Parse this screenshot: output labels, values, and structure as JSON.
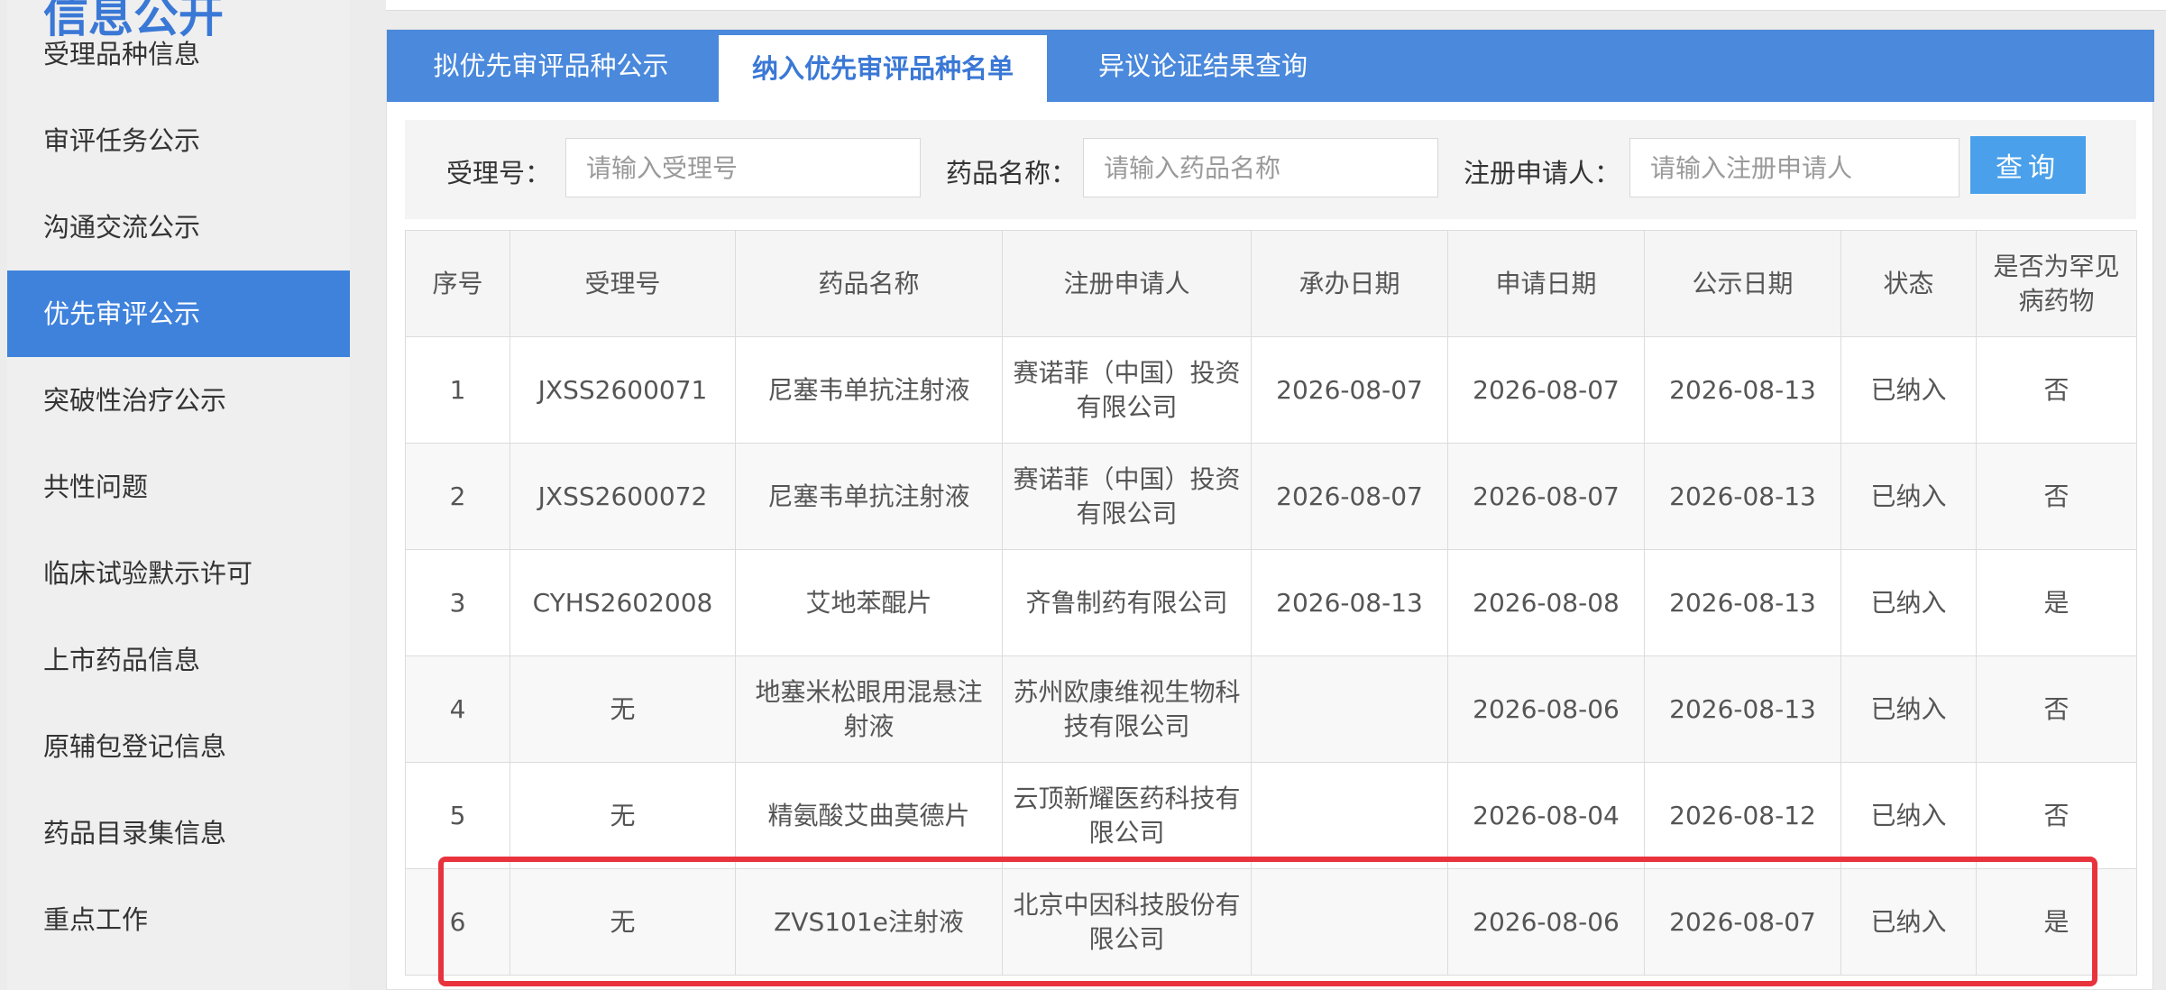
{
  "sidebar": {
    "title": "信息公开",
    "items": [
      {
        "label": "受理品种信息"
      },
      {
        "label": "审评任务公示"
      },
      {
        "label": "沟通交流公示"
      },
      {
        "label": "优先审评公示"
      },
      {
        "label": "突破性治疗公示"
      },
      {
        "label": "共性问题"
      },
      {
        "label": "临床试验默示许可"
      },
      {
        "label": "上市药品信息"
      },
      {
        "label": "原辅包登记信息"
      },
      {
        "label": "药品目录集信息"
      },
      {
        "label": "重点工作"
      }
    ],
    "active_index": 3
  },
  "tabs": [
    {
      "label": "拟优先审评品种公示"
    },
    {
      "label": "纳入优先审评品种名单"
    },
    {
      "label": "异议论证结果查询"
    }
  ],
  "search": {
    "accept_label": "受理号：",
    "accept_placeholder": "请输入受理号",
    "drug_label": "药品名称：",
    "drug_placeholder": "请输入药品名称",
    "applicant_label": "注册申请人：",
    "applicant_placeholder": "请输入注册申请人",
    "button": "查询"
  },
  "table": {
    "headers": [
      "序号",
      "受理号",
      "药品名称",
      "注册申请人",
      "承办日期",
      "申请日期",
      "公示日期",
      "状态",
      "是否为罕见病药物"
    ],
    "rows": [
      [
        "1",
        "JXSS2600071",
        "尼塞韦单抗注射液",
        "赛诺菲（中国）投资有限公司",
        "2026-08-07",
        "2026-08-07",
        "2026-08-13",
        "已纳入",
        "否"
      ],
      [
        "2",
        "JXSS2600072",
        "尼塞韦单抗注射液",
        "赛诺菲（中国）投资有限公司",
        "2026-08-07",
        "2026-08-07",
        "2026-08-13",
        "已纳入",
        "否"
      ],
      [
        "3",
        "CYHS2602008",
        "艾地苯醌片",
        "齐鲁制药有限公司",
        "2026-08-13",
        "2026-08-08",
        "2026-08-13",
        "已纳入",
        "是"
      ],
      [
        "4",
        "无",
        "地塞米松眼用混悬注射液",
        "苏州欧康维视生物科技有限公司",
        "",
        "2026-08-06",
        "2026-08-13",
        "已纳入",
        "否"
      ],
      [
        "5",
        "无",
        "精氨酸艾曲莫德片",
        "云顶新耀医药科技有限公司",
        "",
        "2026-08-04",
        "2026-08-12",
        "已纳入",
        "否"
      ],
      [
        "6",
        "无",
        "ZVS101e注射液",
        "北京中因科技股份有限公司",
        "",
        "2026-08-06",
        "2026-08-07",
        "已纳入",
        "是"
      ]
    ]
  }
}
